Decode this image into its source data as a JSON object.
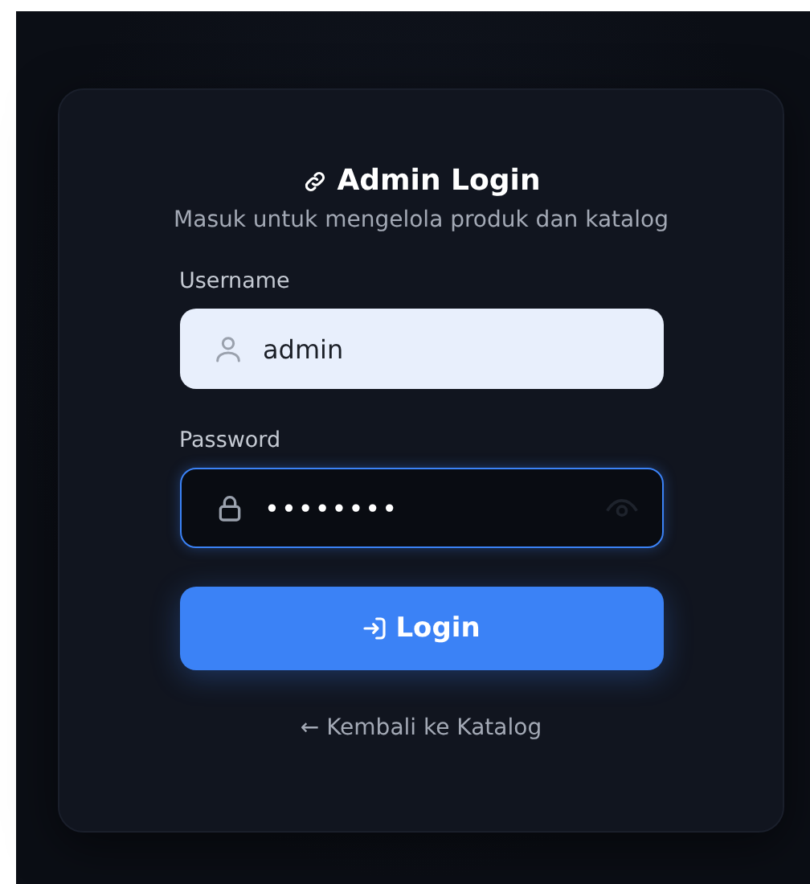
{
  "login": {
    "title": "Admin Login",
    "subtitle": "Masuk untuk mengelola produk dan katalog",
    "fields": [
      {
        "label": "Username",
        "kind": "text",
        "value": "admin",
        "focused": false
      },
      {
        "label": "Password",
        "kind": "password",
        "value": "••••••••",
        "focused": true
      }
    ],
    "submit": "Login",
    "back_link": "← Kembali ke Katalog"
  }
}
